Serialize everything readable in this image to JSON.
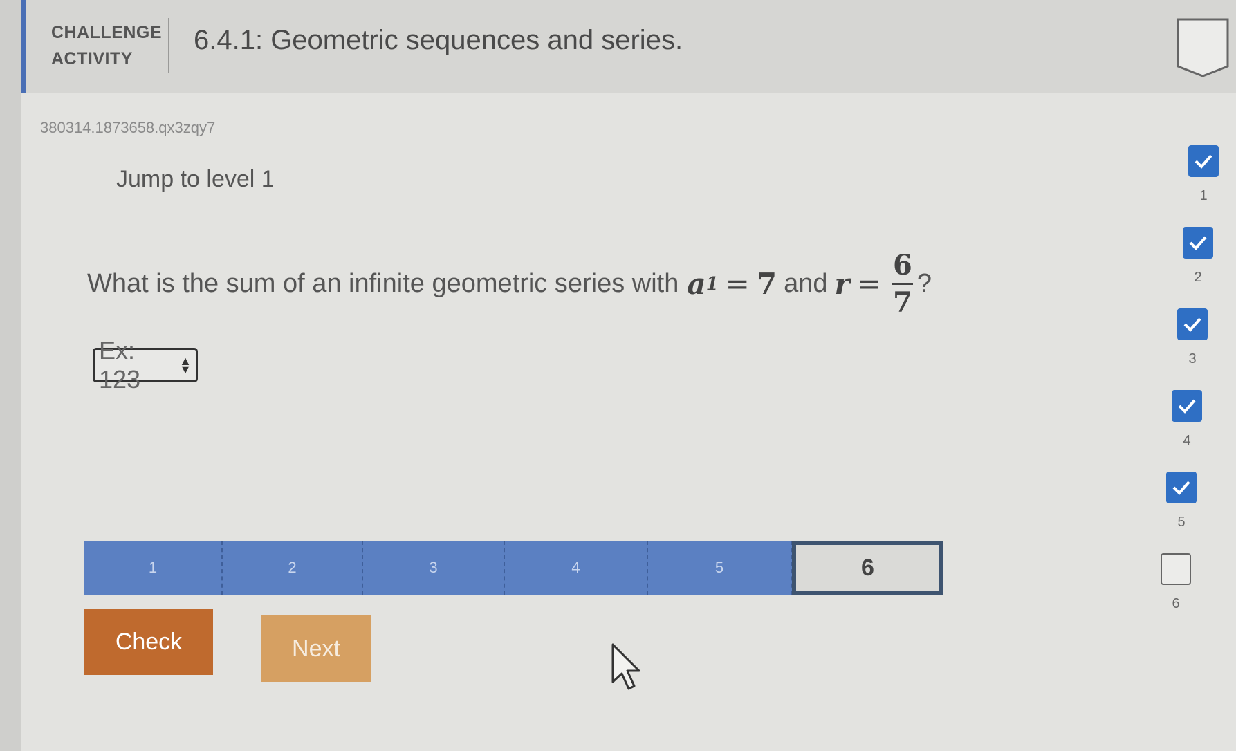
{
  "header": {
    "challenge_line1": "CHALLENGE",
    "challenge_line2": "ACTIVITY",
    "title": "6.4.1: Geometric sequences and series."
  },
  "activity_id": "380314.1873658.qx3zqy7",
  "jump_link": "Jump to level 1",
  "question": {
    "prefix": "What is the sum of an infinite geometric series with",
    "a_var": "a",
    "a_sub": "1",
    "eq": "=",
    "a_val": "7",
    "and": "and",
    "r_var": "r",
    "frac_num": "6",
    "frac_den": "7",
    "suffix": "?"
  },
  "answer": {
    "placeholder": "Ex: 123"
  },
  "level_bar": {
    "segments": [
      "1",
      "2",
      "3",
      "4",
      "5",
      "6"
    ],
    "current": "6"
  },
  "buttons": {
    "check": "Check",
    "next": "Next"
  },
  "level_status": [
    {
      "label": "1",
      "done": true
    },
    {
      "label": "2",
      "done": true
    },
    {
      "label": "3",
      "done": true
    },
    {
      "label": "4",
      "done": true
    },
    {
      "label": "5",
      "done": true
    },
    {
      "label": "6",
      "done": false
    }
  ],
  "colors": {
    "accent": "#4a6fb5",
    "level_bar": "#5b80c2",
    "check_button": "#bf6a2e",
    "next_button": "#d6a062",
    "done_box": "#2f6fc4"
  }
}
